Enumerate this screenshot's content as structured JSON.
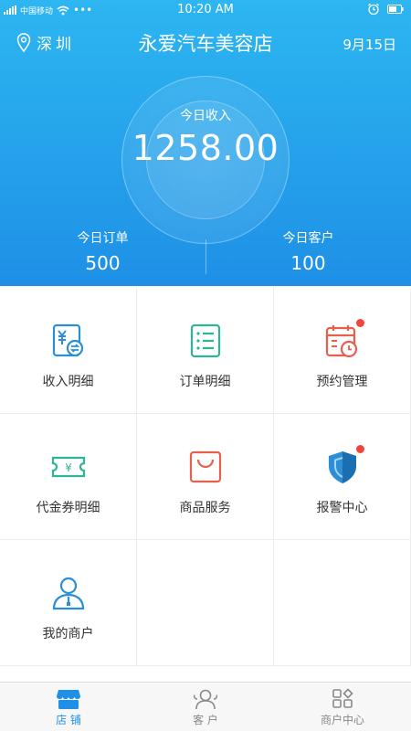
{
  "status_bar": {
    "carrier": "中国移动",
    "dots": "•••",
    "time": "10:20 AM"
  },
  "header": {
    "location": "深圳",
    "title": "永爱汽车美容店",
    "date": "9月15日"
  },
  "summary": {
    "income_label": "今日收入",
    "income_value": "1258.00",
    "orders_label": "今日订单",
    "orders_value": "500",
    "customers_label": "今日客户",
    "customers_value": "100"
  },
  "menu": [
    {
      "label": "收入明细",
      "icon": "income-detail-icon",
      "badge": false
    },
    {
      "label": "订单明细",
      "icon": "order-list-icon",
      "badge": false
    },
    {
      "label": "预约管理",
      "icon": "calendar-clock-icon",
      "badge": true
    },
    {
      "label": "代金券明细",
      "icon": "coupon-icon",
      "badge": false
    },
    {
      "label": "商品服务",
      "icon": "shopping-bag-icon",
      "badge": false
    },
    {
      "label": "报警中心",
      "icon": "shield-icon",
      "badge": true
    },
    {
      "label": "我的商户",
      "icon": "merchant-user-icon",
      "badge": false
    }
  ],
  "tabs": [
    {
      "label": "店 铺",
      "icon": "store-icon",
      "active": true
    },
    {
      "label": "客 户",
      "icon": "customers-icon",
      "active": false
    },
    {
      "label": "商户中心",
      "icon": "merchant-center-icon",
      "active": false
    }
  ],
  "colors": {
    "header_gradient_top": "#2db6f1",
    "header_gradient_bottom": "#1e90e6",
    "blue_icon": "#2a8fd6",
    "green_icon": "#2fb39a",
    "red_icon": "#e8604c",
    "badge": "#f0443c",
    "tab_active": "#1e90e6",
    "tab_inactive": "#888888"
  }
}
